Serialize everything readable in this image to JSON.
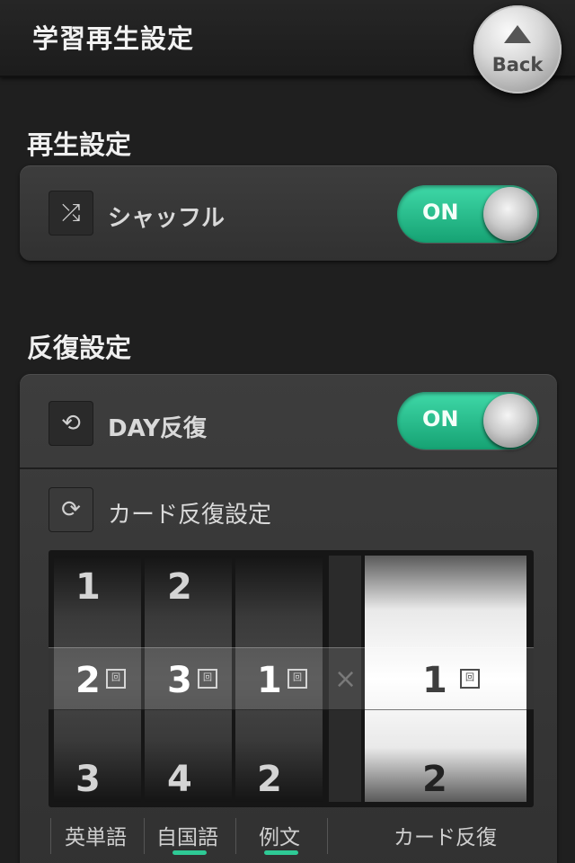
{
  "header": {
    "title": "学習再生設定",
    "back_label": "Back"
  },
  "playback": {
    "section_title": "再生設定",
    "shuffle": {
      "icon": "shuffle-icon",
      "label": "シャッフル",
      "toggle_text": "ON"
    }
  },
  "repeat": {
    "section_title": "反復設定",
    "day_repeat": {
      "icon": "repeat-icon",
      "label": "DAY反復",
      "toggle_text": "ON"
    },
    "card_repeat": {
      "icon": "card-repeat-icon",
      "label": "カード反復設定"
    }
  },
  "picker": {
    "unit": "回",
    "times_symbol": "×",
    "wheels": [
      {
        "label": "英単語",
        "above": "1",
        "selected": "2",
        "below": "3",
        "active": false
      },
      {
        "label": "自国語",
        "above": "2",
        "selected": "3",
        "below": "4",
        "active": true
      },
      {
        "label": "例文",
        "above": "",
        "selected": "1",
        "below": "2",
        "active": true
      }
    ],
    "card_wheel": {
      "label": "カード反復",
      "selected": "1",
      "below": "2"
    }
  },
  "colors": {
    "accent": "#2ec995",
    "background": "#1f1f1f",
    "panel": "#363636"
  }
}
